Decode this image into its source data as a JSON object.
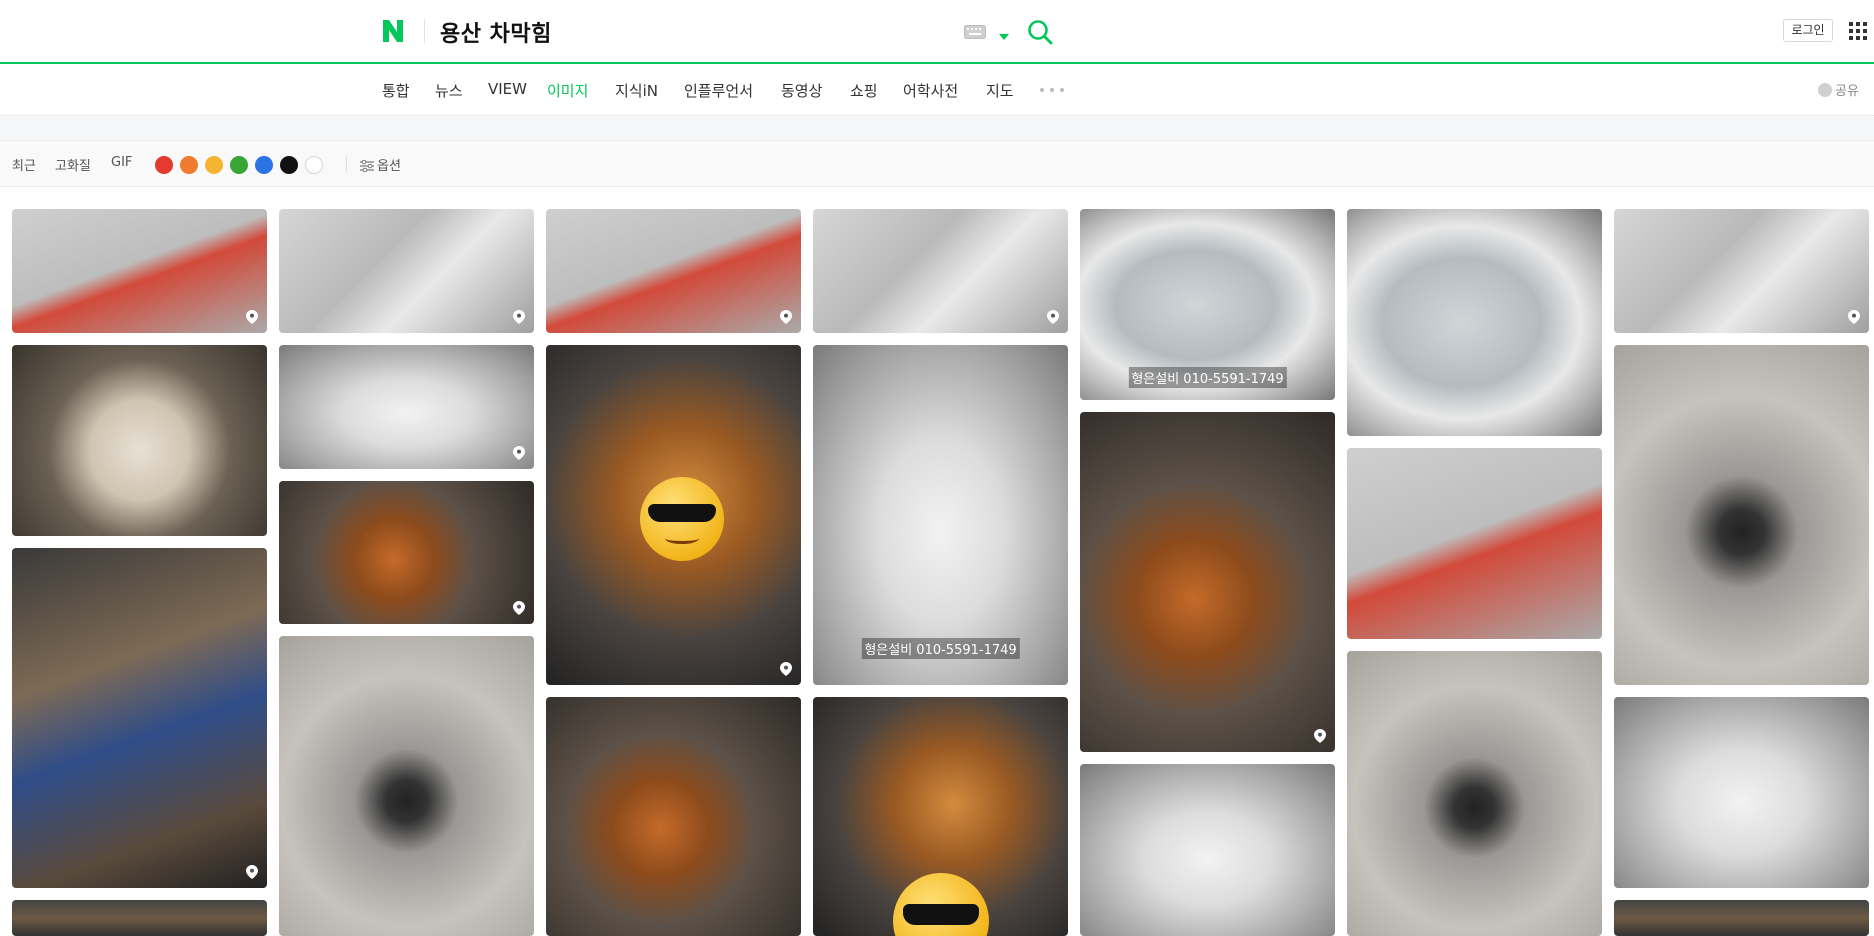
{
  "header": {
    "logo_letter": "N",
    "query": "용산 차막힘",
    "login_label": "로그인",
    "icons": {
      "keyboard": "keyboard-icon",
      "dropdown": "chevron-down-icon",
      "search": "search-icon",
      "apps": "grid-icon"
    }
  },
  "tabs": [
    {
      "label": "통합"
    },
    {
      "label": "뉴스"
    },
    {
      "label": "VIEW"
    },
    {
      "label": "이미지",
      "active": true
    },
    {
      "label": "지식iN"
    },
    {
      "label": "인플루언서"
    },
    {
      "label": "동영상"
    },
    {
      "label": "쇼핑"
    },
    {
      "label": "어학사전"
    },
    {
      "label": "지도"
    }
  ],
  "share_label": "공유",
  "filters": {
    "recent": "최근",
    "hd": "고화질",
    "gif": "GIF",
    "colors": [
      "#e53a2f",
      "#f07a2e",
      "#f5b532",
      "#3aa537",
      "#2b74e3",
      "#111111",
      "#ffffff"
    ],
    "options_label": "옵션"
  },
  "watermark_text": "형은설비 010-5591-1749",
  "accent_color": "#03c75a"
}
